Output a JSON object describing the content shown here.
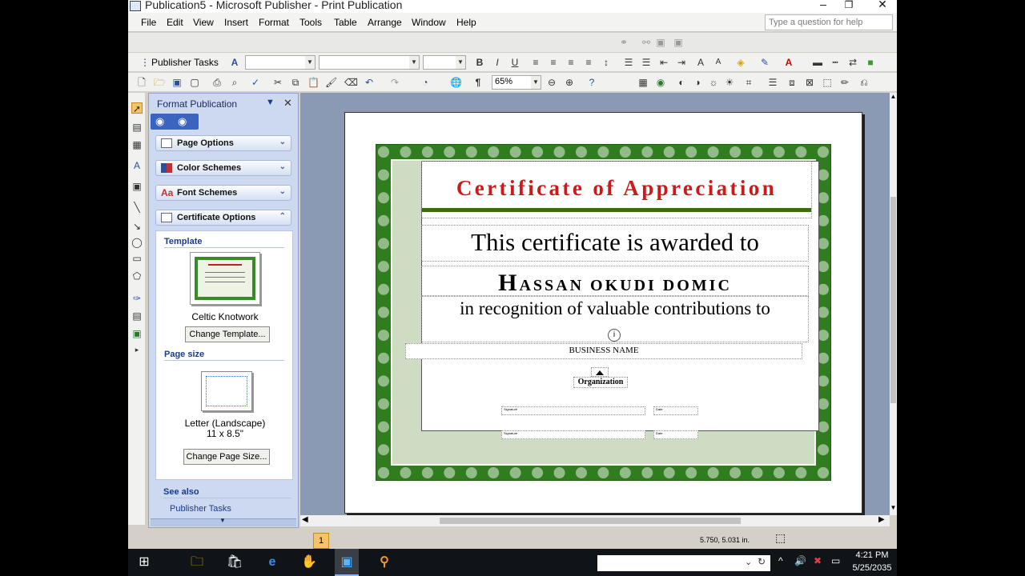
{
  "window": {
    "title": "Publication5 - Microsoft Publisher - Print Publication",
    "controls": {
      "minimize": "–",
      "restore": "❐",
      "close": "✕"
    }
  },
  "menubar": {
    "items": [
      "File",
      "Edit",
      "View",
      "Insert",
      "Format",
      "Tools",
      "Table",
      "Arrange",
      "Window",
      "Help"
    ],
    "help_placeholder": "Type a question for help"
  },
  "formatting_toolbar": {
    "publisher_tasks": "Publisher Tasks",
    "style_value": "",
    "font_value": "",
    "size_value": ""
  },
  "standard_toolbar": {
    "zoom": "65%"
  },
  "task_pane": {
    "title": "Format Publication",
    "sections": [
      "Page Options",
      "Color Schemes",
      "Font Schemes",
      "Certificate Options"
    ],
    "template_heading": "Template",
    "template_name": "Celtic Knotwork",
    "change_template": "Change Template...",
    "page_size_heading": "Page size",
    "page_size_name": "Letter (Landscape)",
    "page_size_dims": "11 x 8.5\"",
    "change_page_size": "Change Page Size...",
    "see_also_heading": "See also",
    "see_also_link": "Publisher Tasks"
  },
  "certificate": {
    "title": "Certificate of Appreciation",
    "awarded_line": "This certificate is awarded to",
    "recipient_initial": "H",
    "recipient_rest": "ASSAN OKUDI DOMIC",
    "recognition_line": "in recognition of valuable contributions to",
    "business_name": "BUSINESS NAME",
    "organization": "Organization",
    "signature_label_1": "Signature",
    "date_label_1": "Date",
    "signature_label_2": "Signature",
    "date_label_2": "Date",
    "colors": {
      "title_red": "#cc1a1a",
      "border_green": "#2f7d1f",
      "rule_green": "#3b6b12"
    }
  },
  "statusbar": {
    "page_number": "1",
    "position": "5.750, 5.031 in."
  },
  "taskbar": {
    "time": "4:21 PM",
    "date": "5/25/2035"
  }
}
